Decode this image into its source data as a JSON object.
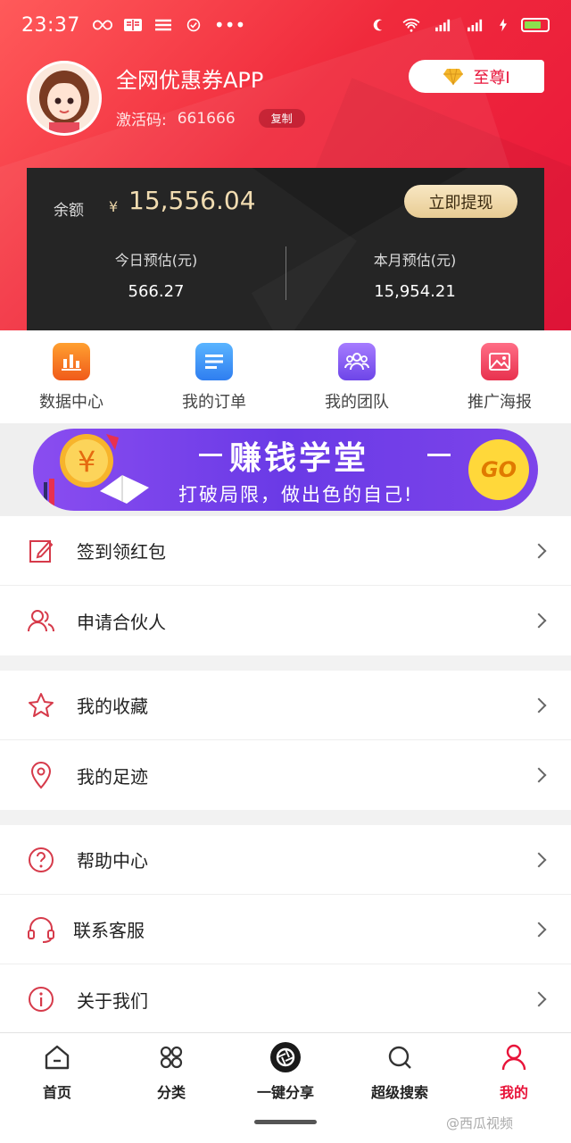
{
  "status_bar": {
    "time": "23:37"
  },
  "profile": {
    "app_name": "全网优惠券APP",
    "code_label": "激活码:",
    "code_value": "661666",
    "copy_label": "复制",
    "vip_label": "至尊I"
  },
  "balance": {
    "label": "余额",
    "currency": "¥",
    "value": "15,556.04",
    "withdraw_label": "立即提现",
    "today_label": "今日预估(元)",
    "today_value": "566.27",
    "month_label": "本月预估(元)",
    "month_value": "15,954.21"
  },
  "quick_menu": [
    {
      "label": "数据中心",
      "icon": "chart-icon",
      "color": "#f26d1a"
    },
    {
      "label": "我的订单",
      "icon": "list-icon",
      "color": "#3b8ff0"
    },
    {
      "label": "我的团队",
      "icon": "team-icon",
      "color": "#8256ee"
    },
    {
      "label": "推广海报",
      "icon": "image-icon",
      "color": "#ee4260"
    }
  ],
  "banner": {
    "title": "赚钱学堂",
    "subtitle": "打破局限，做出色的自己!",
    "go_label": "GO"
  },
  "menu_groups": [
    [
      {
        "label": "签到领红包",
        "icon": "edit-icon"
      },
      {
        "label": "申请合伙人",
        "icon": "users-icon"
      }
    ],
    [
      {
        "label": "我的收藏",
        "icon": "star-icon"
      },
      {
        "label": "我的足迹",
        "icon": "location-icon"
      }
    ],
    [
      {
        "label": "帮助中心",
        "icon": "help-icon"
      },
      {
        "label": "联系客服",
        "icon": "headset-icon"
      },
      {
        "label": "关于我们",
        "icon": "info-icon"
      }
    ]
  ],
  "tabbar": [
    {
      "label": "首页",
      "icon": "home-icon"
    },
    {
      "label": "分类",
      "icon": "category-icon"
    },
    {
      "label": "一键分享",
      "icon": "share-icon"
    },
    {
      "label": "超级搜索",
      "icon": "search-icon"
    },
    {
      "label": "我的",
      "icon": "profile-icon",
      "active": true
    }
  ],
  "watermark": "@西瓜视频"
}
